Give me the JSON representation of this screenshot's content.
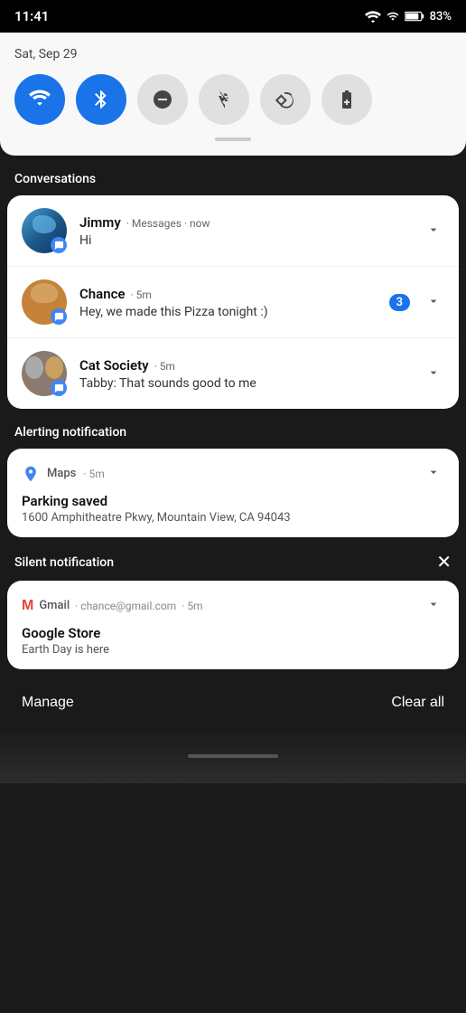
{
  "statusBar": {
    "time": "11:41",
    "battery": "83%"
  },
  "quickSettings": {
    "date": "Sat, Sep 29",
    "toggles": [
      {
        "id": "wifi",
        "label": "WiFi",
        "active": true
      },
      {
        "id": "bluetooth",
        "label": "Bluetooth",
        "active": true
      },
      {
        "id": "dnd",
        "label": "Do Not Disturb",
        "active": false
      },
      {
        "id": "flashlight",
        "label": "Flashlight",
        "active": false
      },
      {
        "id": "rotate",
        "label": "Auto Rotate",
        "active": false
      },
      {
        "id": "battery",
        "label": "Battery Saver",
        "active": false
      }
    ]
  },
  "sections": {
    "conversations": {
      "label": "Conversations",
      "items": [
        {
          "name": "Jimmy",
          "app": "Messages",
          "time": "now",
          "body": "Hi",
          "badge": null
        },
        {
          "name": "Chance",
          "app": null,
          "time": "5m",
          "body": "Hey, we made this Pizza tonight :)",
          "badge": "3"
        },
        {
          "name": "Cat Society",
          "app": null,
          "time": "5m",
          "body": "Tabby: That sounds good to me",
          "badge": null
        }
      ]
    },
    "alerting": {
      "label": "Alerting notification",
      "notification": {
        "app": "Maps",
        "time": "5m",
        "title": "Parking saved",
        "body": "1600 Amphitheatre Pkwy, Mountain View, CA 94043"
      }
    },
    "silent": {
      "label": "Silent notification",
      "notification": {
        "app": "Gmail",
        "email": "chance@gmail.com",
        "time": "5m",
        "title": "Google Store",
        "body": "Earth Day is here"
      }
    }
  },
  "bottomBar": {
    "manage": "Manage",
    "clearAll": "Clear all"
  }
}
